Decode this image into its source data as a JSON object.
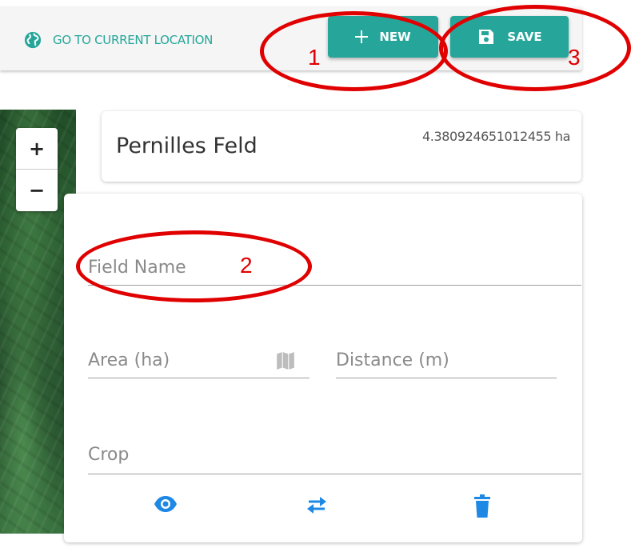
{
  "toolbar": {
    "location_label": "GO TO CURRENT LOCATION",
    "new_label": "NEW",
    "save_label": "SAVE"
  },
  "map": {
    "zoom_in": "+",
    "zoom_out": "−"
  },
  "field_card": {
    "name": "Pernilles Feld",
    "area": "4.380924651012455 ha"
  },
  "form": {
    "name_placeholder": "Field Name",
    "area_placeholder": "Area (ha)",
    "distance_placeholder": "Distance (m)",
    "crop_placeholder": "Crop"
  },
  "icons": {
    "location": "globe-icon",
    "new": "plus-icon",
    "save": "floppy-disk-icon",
    "area": "map-icon",
    "view": "eye-icon",
    "swap": "swap-arrows-icon",
    "delete": "trash-icon"
  },
  "annotations": [
    "1",
    "2",
    "3"
  ],
  "colors": {
    "accent": "#26a69a",
    "action_icon": "#1e88e5",
    "annotation": "#e00000"
  }
}
